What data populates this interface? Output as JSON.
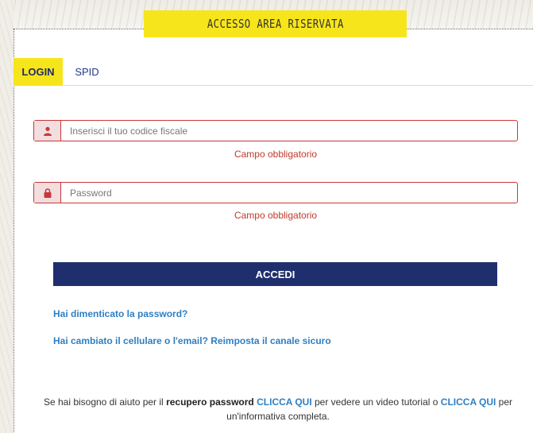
{
  "header": {
    "title": "ACCESSO AREA RISERVATA",
    "accent_color": "#f7e51b"
  },
  "tabs": [
    {
      "label": "LOGIN",
      "active": true
    },
    {
      "label": "SPID",
      "active": false
    }
  ],
  "form": {
    "codice_fiscale": {
      "icon": "user-icon",
      "placeholder": "Inserisci il tuo codice fiscale",
      "value": "",
      "error": "Campo obbligatorio"
    },
    "password": {
      "icon": "lock-icon",
      "placeholder": "Password",
      "value": "",
      "error": "Campo obbligatorio"
    },
    "submit_label": "ACCEDI",
    "submit_color": "#1f2f6e",
    "error_color": "#c0392b"
  },
  "links": {
    "forgot_password": "Hai dimenticato la password?",
    "reset_channel": "Hai cambiato il cellulare o l'email? Reimposta il canale sicuro"
  },
  "help": {
    "text_1": "Se hai bisogno di aiuto per il ",
    "bold_1": "recupero password",
    "link_1": "CLICCA QUI",
    "text_2": " per vedere un video tutorial o ",
    "link_2": "CLICCA QUI",
    "text_3": " per un'informativa completa."
  }
}
